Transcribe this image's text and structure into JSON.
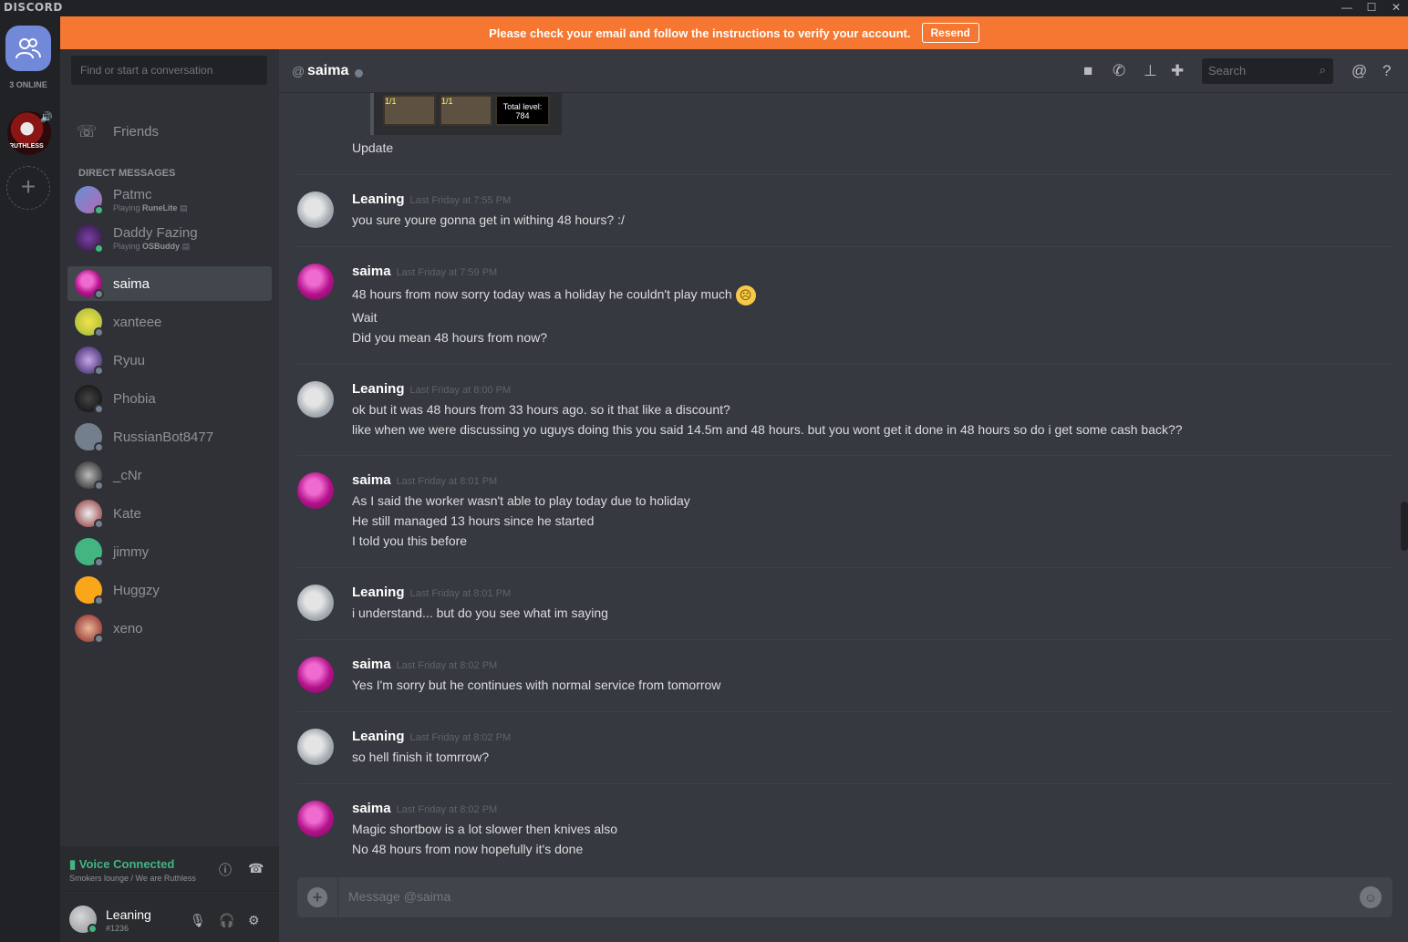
{
  "app": {
    "logo": "DISCORD",
    "window_buttons": [
      "—",
      "☐",
      "✕"
    ]
  },
  "guilds": {
    "online_count": "3 ONLINE",
    "server_tag": "RUTHLESS"
  },
  "banner": {
    "text": "Please check your email and follow the instructions to verify your account.",
    "button": "Resend",
    "color": "#f57731"
  },
  "sidebar": {
    "search_placeholder": "Find or start a conversation",
    "friends_label": "Friends",
    "dm_header": "DIRECT MESSAGES",
    "dms": [
      {
        "name": "Patmc",
        "activity_prefix": "Playing",
        "activity": "RuneLite",
        "status": "online"
      },
      {
        "name": "Daddy Fazing",
        "activity_prefix": "Playing",
        "activity": "OSBuddy",
        "status": "online"
      },
      {
        "name": "saima",
        "status": "offline",
        "active": true
      },
      {
        "name": "xanteee",
        "status": "offline"
      },
      {
        "name": "Ryuu",
        "status": "offline"
      },
      {
        "name": "Phobia",
        "status": "offline"
      },
      {
        "name": "RussianBot8477",
        "status": "offline"
      },
      {
        "name": "_cNr",
        "status": "offline"
      },
      {
        "name": "Kate",
        "status": "offline"
      },
      {
        "name": "jimmy",
        "status": "offline"
      },
      {
        "name": "Huggzy",
        "status": "offline"
      },
      {
        "name": "xeno",
        "status": "offline"
      }
    ],
    "voice": {
      "status": "Voice Connected",
      "channel": "Smokers lounge / We are Ruthless"
    },
    "user": {
      "name": "Leaning",
      "discriminator": "#1236"
    }
  },
  "chat": {
    "at": "@",
    "channel_name": "saima",
    "search_placeholder": "Search",
    "embed_caption": "Update",
    "embed_stats": {
      "slot1": "1/1",
      "slot2": "1/1",
      "total_label": "Total level:",
      "total_value": "784"
    },
    "messages": [
      {
        "author": "Leaning",
        "time": "Last Friday at 7:55 PM",
        "lines": [
          "you sure youre gonna get in withing 48 hours? :/"
        ]
      },
      {
        "author": "saima",
        "time": "Last Friday at 7:59 PM",
        "lines": [
          "48 hours from now sorry today was a holiday he couldn't play much",
          "Wait",
          "Did you mean 48 hours from now?"
        ],
        "emoji": "☹"
      },
      {
        "author": "Leaning",
        "time": "Last Friday at 8:00 PM",
        "lines": [
          "ok but it was 48 hours from 33 hours ago. so it that like a discount?",
          "like when we were discussing yo uguys doing this you said 14.5m and 48 hours. but you wont get it done in 48 hours so do i get some cash back??"
        ]
      },
      {
        "author": "saima",
        "time": "Last Friday at 8:01 PM",
        "lines": [
          "As I said the worker wasn't able to play today due to holiday",
          "He still managed 13 hours since he started",
          "I told you this before"
        ]
      },
      {
        "author": "Leaning",
        "time": "Last Friday at 8:01 PM",
        "lines": [
          "i understand... but do you see what im saying"
        ]
      },
      {
        "author": "saima",
        "time": "Last Friday at 8:02 PM",
        "lines": [
          "Yes I'm sorry but he continues with normal service from tomorrow"
        ]
      },
      {
        "author": "Leaning",
        "time": "Last Friday at 8:02 PM",
        "lines": [
          "so hell finish it tomrrow?"
        ]
      },
      {
        "author": "saima",
        "time": "Last Friday at 8:02 PM",
        "lines": [
          "Magic shortbow is a lot slower then knives also",
          "No 48 hours from now hopefully it's done"
        ]
      }
    ],
    "composer_placeholder": "Message @saima"
  },
  "colors": {
    "accent": "#7289da",
    "online": "#43b581",
    "offline": "#747f8d"
  }
}
